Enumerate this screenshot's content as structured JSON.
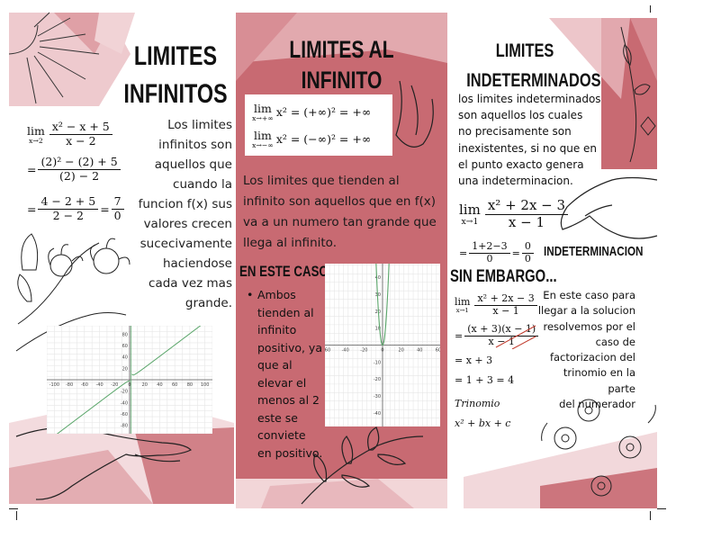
{
  "colors": {
    "panel_red": "#c86a72",
    "rose_light": "#e8b8bd",
    "rose_mid": "#d88e95",
    "dark_red": "#a94854",
    "ink": "#111111"
  },
  "left": {
    "title_line1": "LIMITES",
    "title_line2": "INFINITOS",
    "ex_lim_sub": "x→2",
    "ex_frac1_num": "x² − x + 5",
    "ex_frac1_den": "x − 2",
    "ex_line2_eq": "=",
    "ex_frac2_num": "(2)² − (2) + 5",
    "ex_frac2_den": "(2) − 2",
    "ex_line3_eq": "=",
    "ex_frac3_num": "4 − 2 + 5",
    "ex_frac3_den": "2 − 2",
    "ex_frac3_eq": "=",
    "ex_frac4_num": "7",
    "ex_frac4_den": "0",
    "body_lines": [
      "Los limites",
      "infinitos son",
      "aquellos que",
      "cuando la",
      "funcion f(x) sus",
      "valores crecen",
      "sucecivamente",
      "haciendose",
      "cada vez mas",
      "grande."
    ]
  },
  "middle": {
    "title": "LIMITES AL INFINITO",
    "lim1_sub": "x→+∞",
    "lim1_expr": "x² = (+∞)² = +∞",
    "lim2_sub": "x→−∞",
    "lim2_expr": "x² = (−∞)² = +∞",
    "paragraph": "Los limites que tienden al infinito son aquellos que en f(x) va a un numero tan grande que llega al infinito.",
    "case_heading": "EN ESTE CASO:",
    "bullet_lines": [
      "Ambos",
      "tienden al",
      "infinito",
      "positivo, ya",
      "que al",
      "elevar el",
      "menos al 2",
      "este se",
      "conviete",
      "en positivo."
    ]
  },
  "right": {
    "title_line1": "LIMITES",
    "title_line2": "INDETERMINADOS",
    "intro_lines": [
      "los limites indeterminados",
      "son aquellos los cuales",
      "no precisamente son",
      "inexistentes, si no que en",
      "el punto exacto genera",
      "una indeterminacion."
    ],
    "big_lim_sub": "x→1",
    "big_frac_num": "x² + 2x − 3",
    "big_frac_den": "x − 1",
    "eval_eq": "=",
    "eval_num": "1+2−3",
    "eval_den": "0",
    "eval_eq2": "=",
    "eval_res_num": "0",
    "eval_res_den": "0",
    "indet_label": "INDETERMINACION",
    "sin_embargo": "SIN EMBARGO...",
    "s_lim_sub": "x→1",
    "s_frac_num": "x² + 2x − 3",
    "s_frac_den": "x − 1",
    "s_line2_eq": "=",
    "s_factor_num": "(x + 3)(x − 1)",
    "s_factor_den": "x − 1",
    "s_line3": "= x + 3",
    "s_line4": "= 1 + 3 = 4",
    "trinomio": "Trinomio",
    "trinomio_expr": "x² + bx + c",
    "note_lines": [
      "En este caso para",
      "llegar a la solucion",
      "resolvemos por el",
      "caso de",
      "factorizacion del",
      "trinomio en la parte",
      "del numerador"
    ]
  },
  "graph_left": {
    "x_ticks": [
      "-100",
      "-80",
      "-60",
      "-40",
      "-20",
      "0",
      "20",
      "40",
      "60",
      "80",
      "100"
    ],
    "y_ticks": [
      "80",
      "60",
      "40",
      "20",
      "-20",
      "-40",
      "-60",
      "-80"
    ]
  },
  "graph_middle": {
    "x_ticks": [
      "-60",
      "-40",
      "-20",
      "0",
      "20",
      "40",
      "60"
    ],
    "y_ticks": [
      "40",
      "30",
      "20",
      "10",
      "-10",
      "-20",
      "-30",
      "-40"
    ]
  }
}
